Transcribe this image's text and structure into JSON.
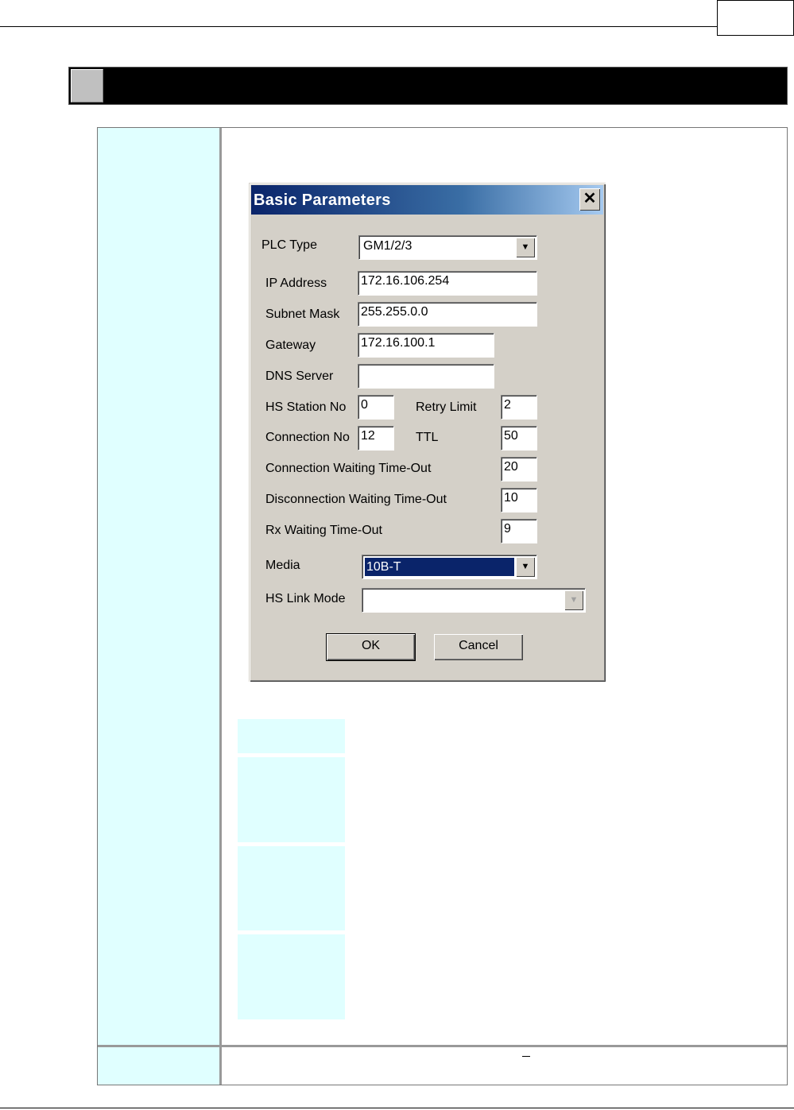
{
  "dialog": {
    "title": "Basic Parameters",
    "close_icon": "close-icon",
    "plc_type": {
      "label": "PLC Type",
      "value": "GM1/2/3"
    },
    "ip_address": {
      "label": "IP Address",
      "value": "172.16.106.254"
    },
    "subnet_mask": {
      "label": "Subnet Mask",
      "value": "255.255.0.0"
    },
    "gateway": {
      "label": "Gateway",
      "value": "172.16.100.1"
    },
    "dns_server": {
      "label": "DNS Server",
      "value": ""
    },
    "hs_station_no": {
      "label": "HS Station No",
      "value": "0"
    },
    "retry_limit": {
      "label": "Retry Limit",
      "value": "2"
    },
    "connection_no": {
      "label": "Connection No",
      "value": "12"
    },
    "ttl": {
      "label": "TTL",
      "value": "50"
    },
    "conn_wait": {
      "label": "Connection Waiting Time-Out",
      "value": "20"
    },
    "disconn_wait": {
      "label": "Disconnection Waiting Time-Out",
      "value": "10"
    },
    "rx_wait": {
      "label": "Rx Waiting Time-Out",
      "value": "9"
    },
    "media": {
      "label": "Media",
      "value": "10B-T"
    },
    "hs_link_mode": {
      "label": "HS Link Mode",
      "value": ""
    },
    "ok_label": "OK",
    "cancel_label": "Cancel"
  },
  "colors": {
    "cell_background": "#e0ffff",
    "dialog_face": "#d4d0c8",
    "titlebar_start": "#0a246a",
    "selection": "#0a246a"
  }
}
